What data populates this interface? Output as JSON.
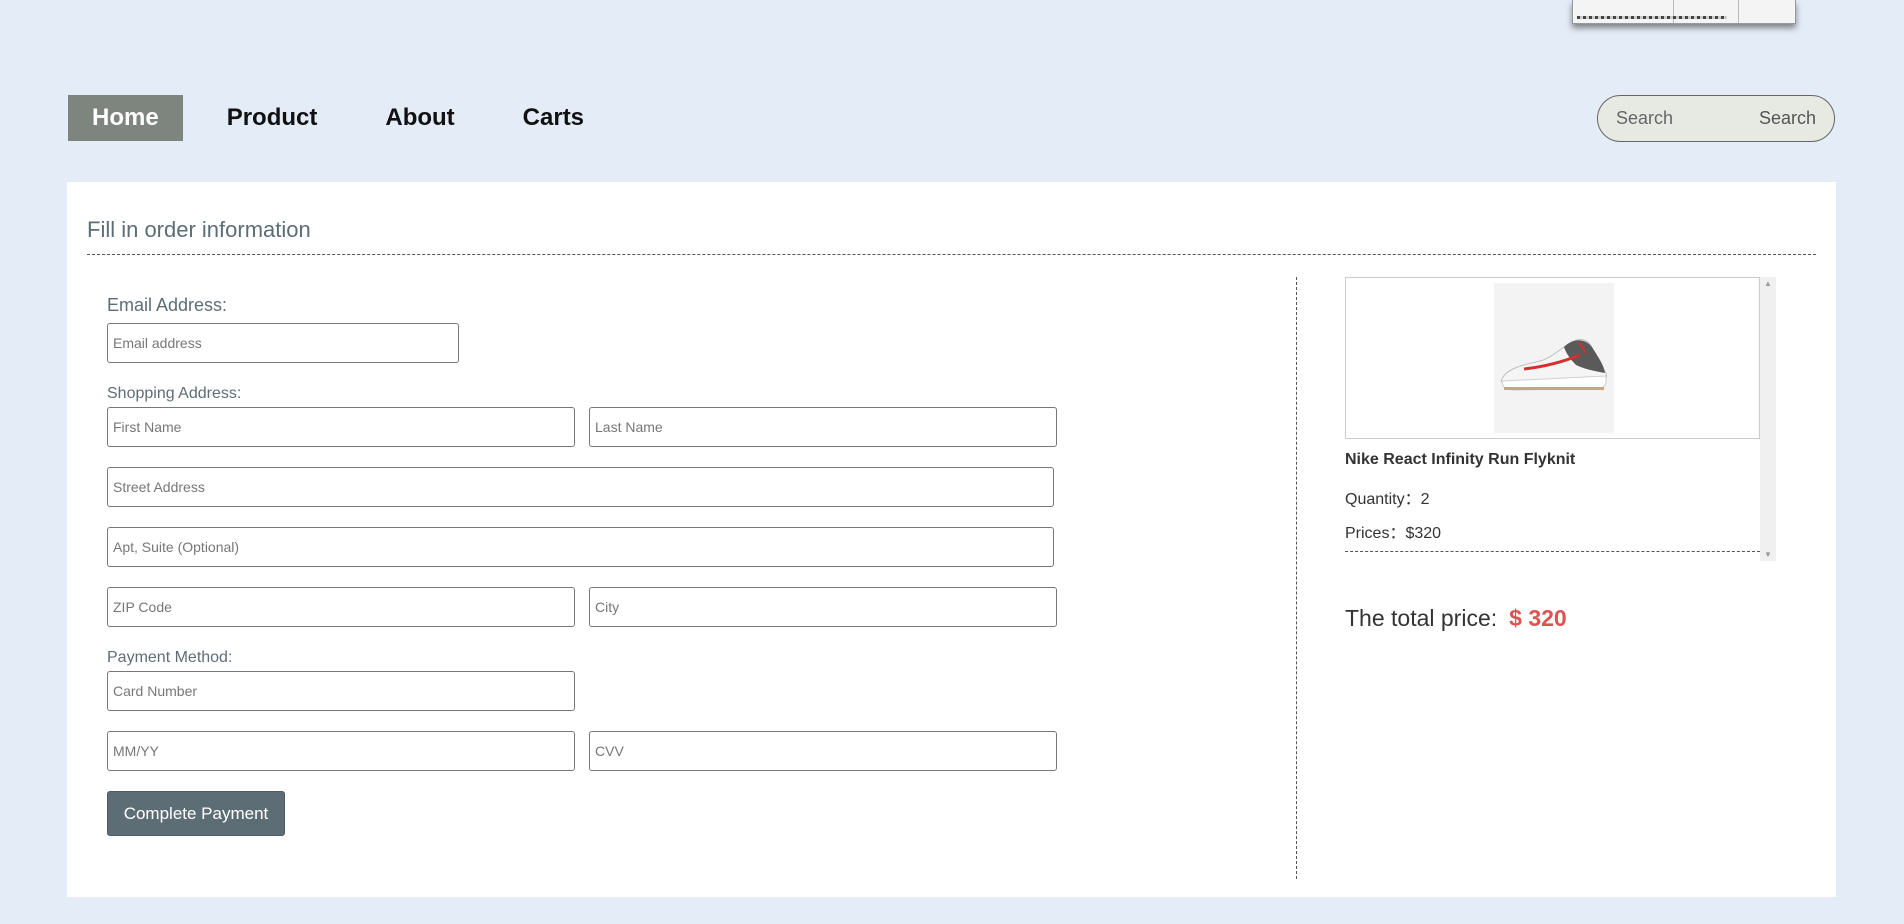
{
  "nav": {
    "items": [
      "Home",
      "Product",
      "About",
      "Carts"
    ],
    "active": "Home"
  },
  "search": {
    "placeholder": "Search",
    "button_label": "Search"
  },
  "form": {
    "title": "Fill in order information",
    "email_label": "Email Address:",
    "email_placeholder": "Email address",
    "shipping_label": "Shopping Address:",
    "first_name_placeholder": "First Name",
    "last_name_placeholder": "Last Name",
    "street_placeholder": "Street Address",
    "apt_placeholder": "Apt, Suite (Optional)",
    "zip_placeholder": "ZIP Code",
    "city_placeholder": "City",
    "payment_label": "Payment Method:",
    "card_placeholder": "Card Number",
    "expiry_placeholder": "MM/YY",
    "cvv_placeholder": "CVV",
    "submit_label": "Complete Payment"
  },
  "cart": {
    "items": [
      {
        "name": "Nike React Infinity Run Flyknit",
        "quantity_text": "Quantity：2",
        "price_text": "Prices：$320"
      }
    ],
    "total_label": "The total price:",
    "total_value": "$ 320"
  },
  "colors": {
    "page_bg": "#e4ecf7",
    "nav_active": "#7d857e",
    "accent": "#5d6d76",
    "total_price": "#e05252"
  }
}
